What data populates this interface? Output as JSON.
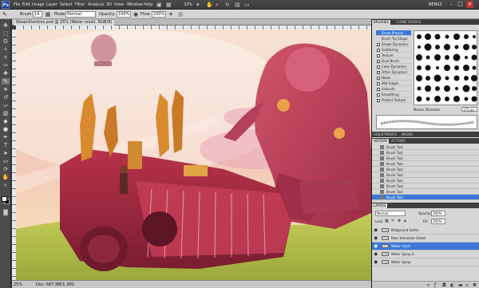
{
  "menubar": {
    "app_logo": "Ps",
    "items": [
      "File",
      "Edit",
      "Image",
      "Layer",
      "Select",
      "Filter",
      "Analysis",
      "3D",
      "View",
      "Window",
      "Help"
    ],
    "zoom": "33%",
    "workspace": "BENS2",
    "window_buttons": [
      "–",
      "□",
      "×"
    ]
  },
  "options": {
    "tool_icon": "brush-icon",
    "brush_label": "Brush:",
    "brush_size": "14",
    "mode_label": "Mode:",
    "mode_value": "Normal",
    "opacity_label": "Opacity:",
    "opacity_value": "100%",
    "flow_label": "Flow:",
    "flow_value": "100%"
  },
  "document": {
    "tab_title": "SteamDonkies.psd @ 25% (Water resist, RGB/8)",
    "zoom": "25%",
    "doc_size": "Doc: 667.9M/1.30G"
  },
  "brushes_panel": {
    "tabs": [
      "BRUSHES",
      "CLONE SOURCE"
    ],
    "options": [
      "Brush Presets",
      "Brush Tip Shape",
      "Shape Dynamics",
      "Scattering",
      "Texture",
      "Dual Brush",
      "Color Dynamics",
      "Other Dynamics",
      "Noise",
      "Wet Edges",
      "Airbrush",
      "Smoothing",
      "Protect Texture"
    ],
    "master_diameter_label": "Master Diameter",
    "master_diameter_value": "175 px"
  },
  "adjustments_panel": {
    "tabs": [
      "ADJUSTMENTS",
      "MASKS"
    ]
  },
  "history_panel": {
    "tabs": [
      "HISTORY",
      "ACTIONS"
    ],
    "items": [
      "Brush Tool",
      "Brush Tool",
      "Brush Tool",
      "Brush Tool",
      "Brush Tool",
      "Brush Tool",
      "Brush Tool",
      "Brush Tool",
      "Brush Tool",
      "Brush Tool"
    ],
    "selected_index": 9
  },
  "layers_panel": {
    "tabs": [
      "LAYERS"
    ],
    "blend_mode": "Normal",
    "opacity_label": "Opacity:",
    "opacity_value": "100%",
    "lock_label": "Lock:",
    "fill_label": "Fill:",
    "fill_value": "100%",
    "layers": [
      "Midground Outlin",
      "Reer Harvester Detail",
      "Water resist",
      "Water Spray 2",
      "Water Spray"
    ],
    "selected_index": 2
  },
  "colors": {
    "accent": "#3b78d8",
    "foreground": "#ffffff",
    "background": "#000000"
  }
}
